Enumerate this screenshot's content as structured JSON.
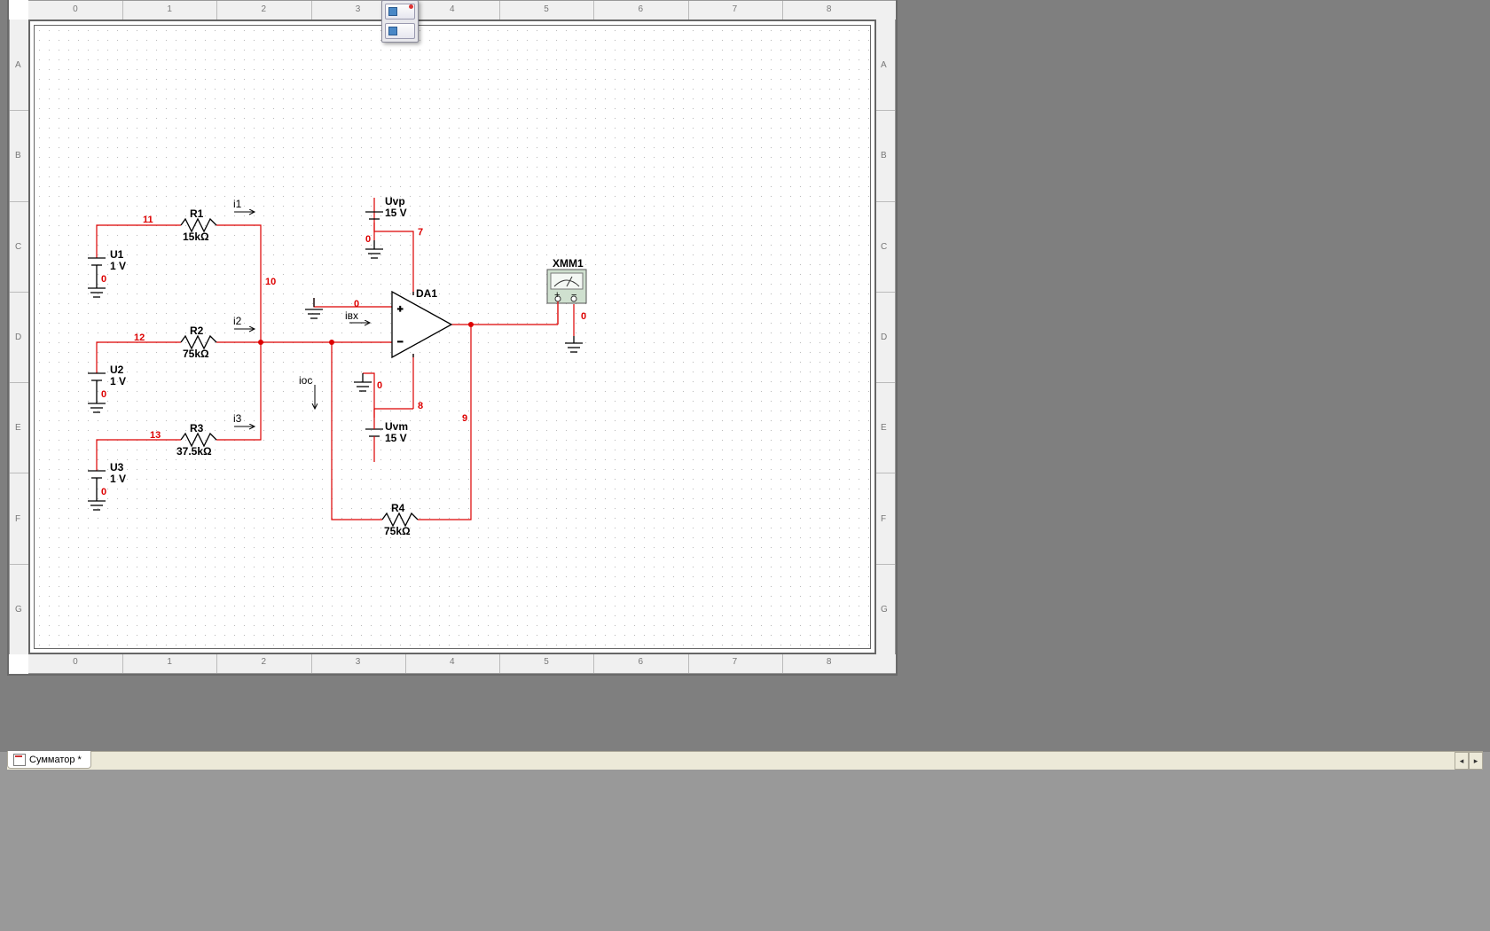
{
  "tab": {
    "title": "Сумматор *"
  },
  "toolbar": {},
  "rulers": {
    "cols": [
      "0",
      "1",
      "2",
      "3",
      "4",
      "5",
      "6",
      "7",
      "8"
    ],
    "rows": [
      "A",
      "B",
      "C",
      "D",
      "E",
      "F",
      "G"
    ]
  },
  "components": {
    "U1": {
      "ref": "U1",
      "value": "1 V"
    },
    "U2": {
      "ref": "U2",
      "value": "1 V"
    },
    "U3": {
      "ref": "U3",
      "value": "1 V"
    },
    "R1": {
      "ref": "R1",
      "value": "15kΩ"
    },
    "R2": {
      "ref": "R2",
      "value": "75kΩ"
    },
    "R3": {
      "ref": "R3",
      "value": "37.5kΩ"
    },
    "R4": {
      "ref": "R4",
      "value": "75kΩ"
    },
    "Uvp": {
      "ref": "Uvp",
      "value": "15 V"
    },
    "Uvm": {
      "ref": "Uvm",
      "value": "15 V"
    },
    "DA1": {
      "ref": "DA1"
    },
    "XMM1": {
      "ref": "XMM1"
    }
  },
  "net_numbers": {
    "n11": "11",
    "n12": "12",
    "n13": "13",
    "n10": "10",
    "n7": "7",
    "n8": "8",
    "n9": "9",
    "n0a": "0",
    "n0b": "0",
    "n0c": "0",
    "n0d": "0",
    "n0e": "0",
    "n0f": "0",
    "n0g": "0"
  },
  "current_labels": {
    "i1": "i1",
    "i2": "i2",
    "i3": "i3",
    "ivx": "iвх",
    "ioc": "iос"
  },
  "instrument": {
    "name": "XMM1",
    "plus": "+",
    "minus": "–"
  }
}
